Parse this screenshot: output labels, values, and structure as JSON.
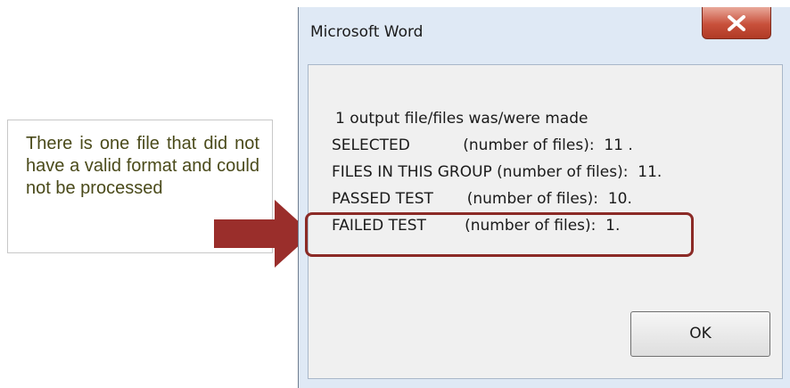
{
  "callout": {
    "text": "There is one file that did not have a valid format and could not be processed"
  },
  "dialog": {
    "title": "Microsoft Word",
    "close_label": "X",
    "lines": [
      "1 output file/files was/were made",
      "SELECTED           (number of files):  11 .",
      "FILES IN THIS GROUP (number of files):  11.",
      "PASSED TEST       (number of files):  10.",
      "FAILED TEST        (number of files):  1."
    ],
    "ok_label": "OK"
  },
  "colors": {
    "arrow": "#9a2e2b",
    "highlight_border": "#8b2a26",
    "close_button": "#c8503b"
  },
  "icons": {
    "close": "close-icon"
  }
}
